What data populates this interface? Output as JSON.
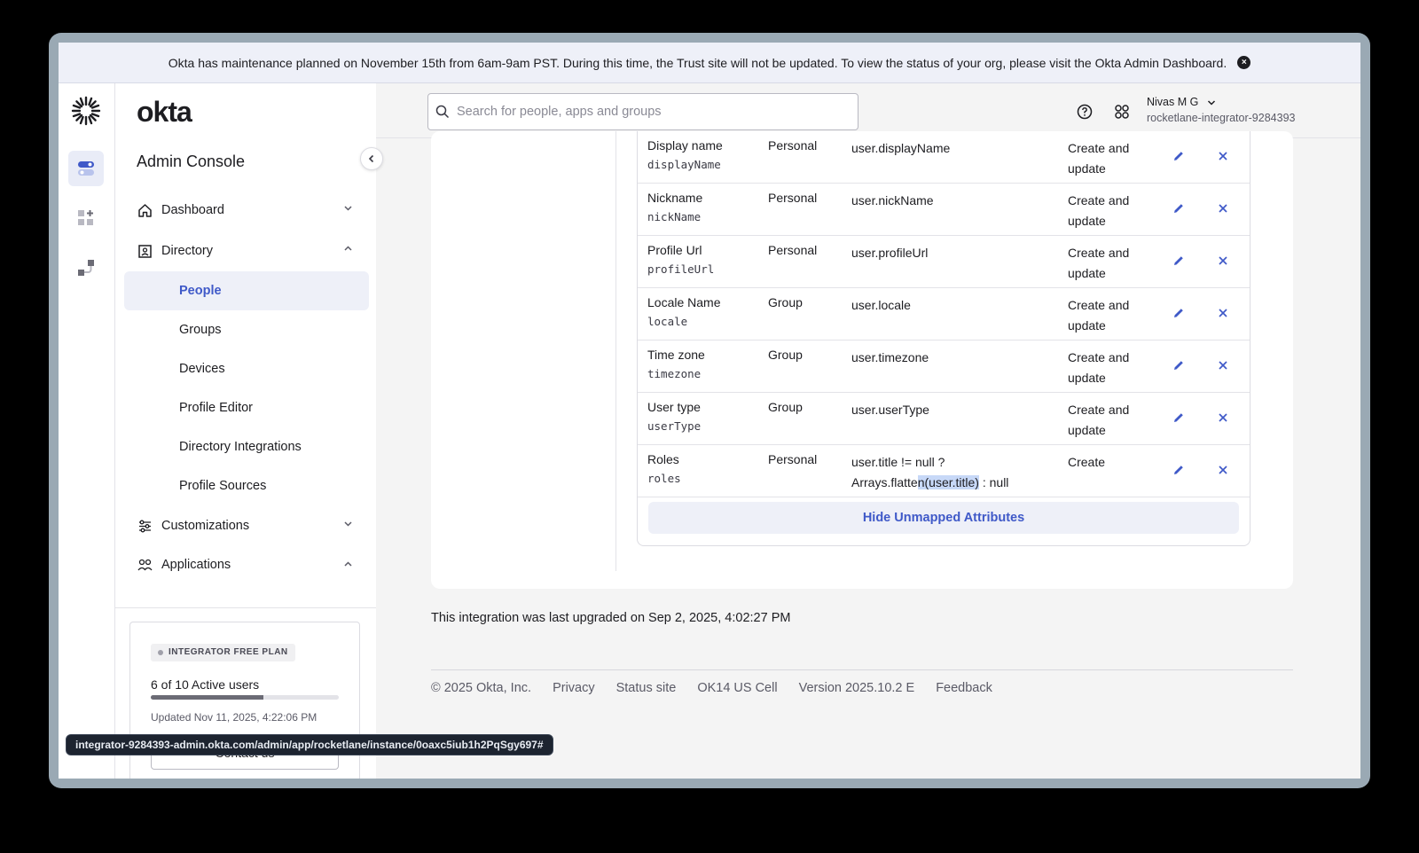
{
  "banner": {
    "text": "Okta has maintenance planned on November 15th from 6am-9am PST. During this time, the Trust site will not be updated. To view the status of your org, please visit the Okta Admin Dashboard.",
    "close_label": "×"
  },
  "sidebar": {
    "brand": "okta",
    "title": "Admin Console",
    "nav": {
      "dashboard": "Dashboard",
      "directory": "Directory",
      "customizations": "Customizations",
      "applications": "Applications"
    },
    "directory_items": [
      "People",
      "Groups",
      "Devices",
      "Profile Editor",
      "Directory Integrations",
      "Profile Sources"
    ],
    "active_item": "People"
  },
  "plan": {
    "badge": "INTEGRATOR FREE PLAN",
    "users": "6 of 10 Active users",
    "active_users": 6,
    "max_users": 10,
    "updated": "Updated Nov 11, 2025, 4:22:06 PM",
    "contact": "Contact us"
  },
  "topbar": {
    "search_placeholder": "Search for people, apps and groups",
    "user_name": "Nivas M G",
    "user_org": "rocketlane-integrator-9284393"
  },
  "mappings": [
    {
      "name": "Display name",
      "api": "displayName",
      "type": "Personal",
      "expr": "user.displayName",
      "apply": "Create and update"
    },
    {
      "name": "Nickname",
      "api": "nickName",
      "type": "Personal",
      "expr": "user.nickName",
      "apply": "Create and update"
    },
    {
      "name": "Profile Url",
      "api": "profileUrl",
      "type": "Personal",
      "expr": "user.profileUrl",
      "apply": "Create and update"
    },
    {
      "name": "Locale Name",
      "api": "locale",
      "type": "Group",
      "expr": "user.locale",
      "apply": "Create and update"
    },
    {
      "name": "Time zone",
      "api": "timezone",
      "type": "Group",
      "expr": "user.timezone",
      "apply": "Create and update"
    },
    {
      "name": "User type",
      "api": "userType",
      "type": "Group",
      "expr": "user.userType",
      "apply": "Create and update"
    },
    {
      "name": "Roles",
      "api": "roles",
      "type": "Personal",
      "expr_line1": "user.title != null ?",
      "expr_line2_pre": "Arrays.flatte",
      "expr_line2_hl": "n(user.title)",
      "expr_line2_post": " : null",
      "apply": "Create"
    }
  ],
  "hide_button": "Hide Unmapped Attributes",
  "upgraded": "This integration was last upgraded on Sep 2, 2025, 4:02:27 PM",
  "footer": [
    "© 2025 Okta, Inc.",
    "Privacy",
    "Status site",
    "OK14 US Cell",
    "Version 2025.10.2 E",
    "Feedback"
  ],
  "status_url": "integrator-9284393-admin.okta.com/admin/app/rocketlane/instance/0oaxc5iub1h2PqSgy697#",
  "colors": {
    "accent": "#3f59c8",
    "active_bg": "#eef0f8"
  }
}
